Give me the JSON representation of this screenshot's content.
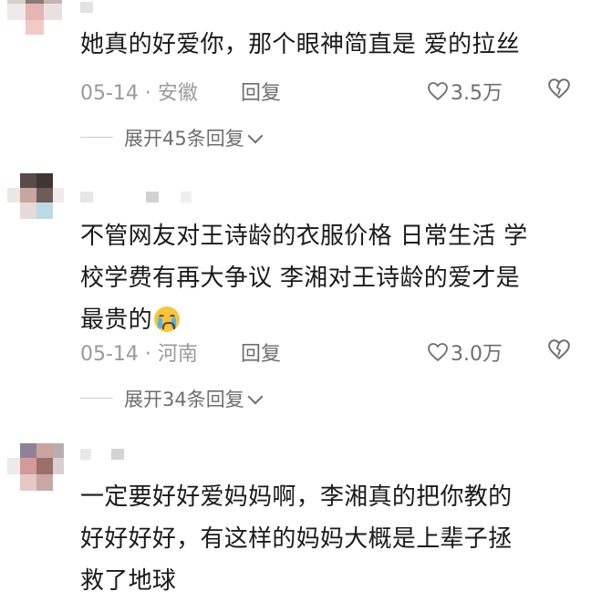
{
  "comments": [
    {
      "text": "她真的好爱你，那个眼神简直是 爱的拉丝",
      "date": "05-14 · 安徽",
      "reply_label": "回复",
      "likes": "3.5万",
      "expand_label": "展开45条回复"
    },
    {
      "text": "不管网友对王诗龄的衣服价格 日常生活 学\n校学费有再大争议 李湘对王诗龄的爱才是\n最贵的",
      "emoji": "crying-face",
      "date": "05-14 · 河南",
      "reply_label": "回复",
      "likes": "3.0万",
      "expand_label": "展开34条回复"
    },
    {
      "text": "一定要好好爱妈妈啊，李湘真的把你教的\n好好好好，有这样的妈妈大概是上辈子拯\n救了地球"
    }
  ],
  "icons": {
    "like": "heart-outline-icon",
    "dislike": "broken-heart-outline-icon",
    "expand": "chevron-down-icon"
  },
  "colors": {
    "text": "#1a1a1a",
    "meta": "#9a9a9a",
    "action": "#6e6e6e",
    "emoji": "#f6c53b"
  }
}
